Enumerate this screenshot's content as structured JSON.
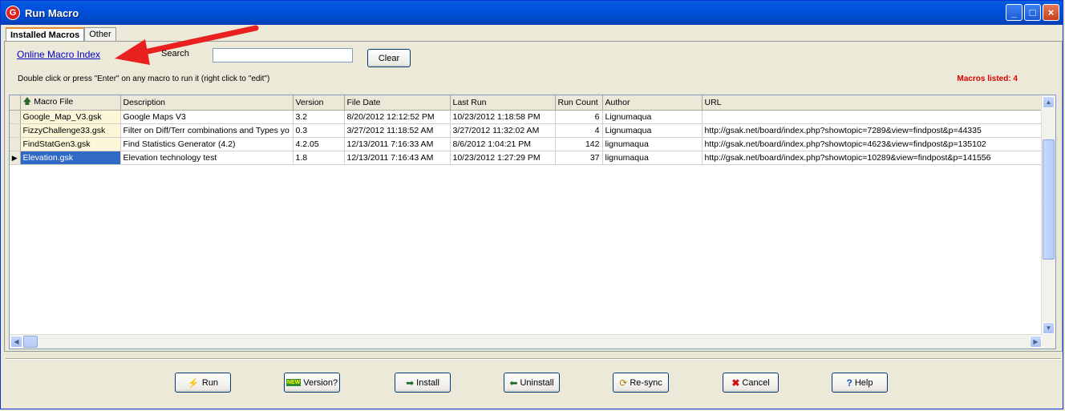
{
  "window": {
    "title": "Run Macro",
    "controls": {
      "minimize": "_",
      "maximize": "□",
      "close": "×"
    }
  },
  "tabs": [
    {
      "label": "Installed Macros",
      "active": true
    },
    {
      "label": "Other",
      "active": false
    }
  ],
  "toolbar": {
    "online_link": "Online Macro Index",
    "search_label": "Search",
    "search_value": "",
    "clear_label": "Clear",
    "hint": "Double click or press \"Enter\" on any macro to run it (right click to \"edit\")",
    "macros_listed": "Macros listed: 4"
  },
  "table": {
    "columns": [
      "Macro File",
      "Description",
      "Version",
      "File Date",
      "Last Run",
      "Run Count",
      "Author",
      "URL"
    ],
    "rows": [
      {
        "file": "Google_Map_V3.gsk",
        "description": "Google Maps V3",
        "version": "3.2",
        "file_date": "8/20/2012 12:12:52 PM",
        "last_run": "10/23/2012 1:18:58 PM",
        "run_count": "6",
        "author": "Lignumaqua",
        "url": ""
      },
      {
        "file": "FizzyChallenge33.gsk",
        "description": "Filter on Diff/Terr combinations and Types yo",
        "version": "0.3",
        "file_date": "3/27/2012 11:18:52 AM",
        "last_run": "3/27/2012 11:32:02 AM",
        "run_count": "4",
        "author": "Lignumaqua",
        "url": "http://gsak.net/board/index.php?showtopic=7289&view=findpost&p=44335"
      },
      {
        "file": "FindStatGen3.gsk",
        "description": "Find Statistics Generator (4.2)",
        "version": "4.2.05",
        "file_date": "12/13/2011 7:16:33 AM",
        "last_run": "8/6/2012 1:04:21 PM",
        "run_count": "142",
        "author": "lignumaqua",
        "url": "http://gsak.net/board/index.php?showtopic=4623&view=findpost&p=135102"
      },
      {
        "file": "Elevation.gsk",
        "description": "Elevation technology test",
        "version": "1.8",
        "file_date": "12/13/2011 7:16:43 AM",
        "last_run": "10/23/2012 1:27:29 PM",
        "run_count": "37",
        "author": "lignumaqua",
        "url": "http://gsak.net/board/index.php?showtopic=10289&view=findpost&p=141556"
      }
    ],
    "selected_index": 3
  },
  "buttons": {
    "run": "Run",
    "version": "Version?",
    "install": "Install",
    "uninstall": "Uninstall",
    "resync": "Re-sync",
    "cancel": "Cancel",
    "help": "Help"
  },
  "colors": {
    "title_bar": "#0054e3",
    "link": "#0000cc",
    "macros_listed": "#dd0000",
    "selected_row": "#316ac5",
    "annotation_arrow": "#e82020"
  }
}
